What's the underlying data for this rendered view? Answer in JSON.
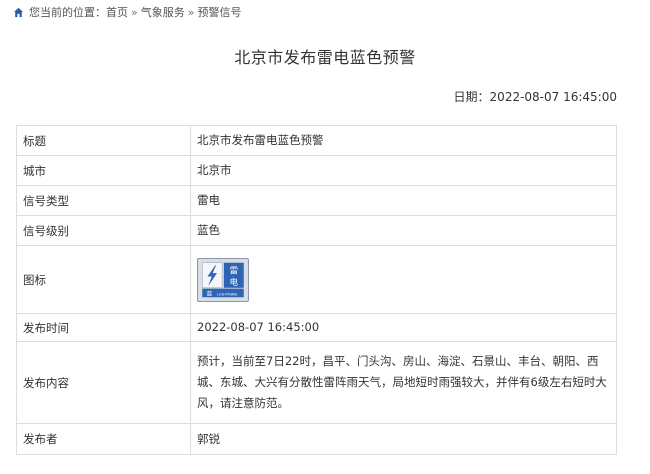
{
  "breadcrumb": {
    "prefix": "您当前的位置：",
    "items": [
      "首页",
      "气象服务",
      "预警信号"
    ],
    "separator": "»"
  },
  "page_title": "北京市发布雷电蓝色预警",
  "date": {
    "label": "日期：",
    "value": "2022-08-07 16:45:00"
  },
  "table": {
    "rows": [
      {
        "label": "标题",
        "value": "北京市发布雷电蓝色预警"
      },
      {
        "label": "城市",
        "value": "北京市"
      },
      {
        "label": "信号类型",
        "value": "雷电"
      },
      {
        "label": "信号级别",
        "value": "蓝色"
      },
      {
        "label": "图标",
        "value": ""
      },
      {
        "label": "发布时间",
        "value": "2022-08-07 16:45:00"
      },
      {
        "label": "发布内容",
        "value": "预计，当前至7日22时，昌平、门头沟、房山、海淀、石景山、丰台、朝阳、西城、东城、大兴有分散性雷阵雨天气，局地短时雨强较大，并伴有6级左右短时大风，请注意防范。"
      },
      {
        "label": "发布者",
        "value": "郭锐"
      }
    ]
  },
  "icon_badge": {
    "name": "lightning-blue-warning-icon",
    "title_chars": "雷电",
    "level_char": "蓝",
    "en_label": "LIGHTNING",
    "colors": {
      "blue": "#2f63b3",
      "light_panel": "#d9dde6",
      "bolt": "#2f63b3"
    }
  },
  "colors": {
    "border": "#dddddd",
    "text": "#333333",
    "breadcrumb_icon": "#2a5fa8"
  }
}
